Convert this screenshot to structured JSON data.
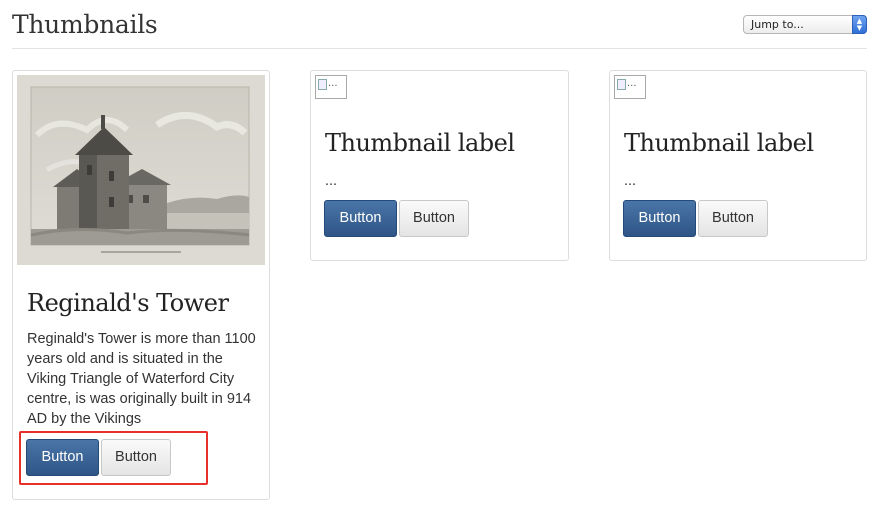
{
  "header": {
    "title": "Thumbnails",
    "jump_select": {
      "value": "Jump to...",
      "icon": "select-arrows-icon"
    }
  },
  "cards": [
    {
      "image": {
        "type": "photo",
        "subject": "engraving of a round stone tower"
      },
      "title": "Reginald's Tower",
      "text": "Reginald's Tower is more than 1100 years old and is situated in the Viking Triangle of Waterford City centre, is was originally built in 914 AD by the Vikings",
      "primary_button": "Button",
      "default_button": "Button",
      "highlighted_buttons": true
    },
    {
      "image": {
        "type": "broken",
        "alt": "..."
      },
      "title": "Thumbnail label",
      "text": "...",
      "primary_button": "Button",
      "default_button": "Button"
    },
    {
      "image": {
        "type": "broken",
        "alt": "..."
      },
      "title": "Thumbnail label",
      "text": "...",
      "primary_button": "Button",
      "default_button": "Button"
    }
  ],
  "colors": {
    "primary_button": "#3d6699",
    "highlight": "#e8302a"
  }
}
